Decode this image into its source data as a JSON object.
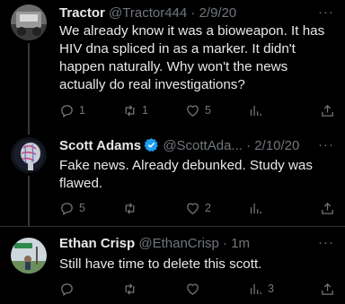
{
  "tweets": [
    {
      "name": "Tractor",
      "handle": "@Tractor444",
      "time": "· 2/9/20",
      "text": "We already know it was a bioweapon. It has HIV dna spliced in as a marker. It didn't happen naturally. Why won't the news actually do real investigations?",
      "replies": "1",
      "retweets": "1",
      "likes": "5",
      "views": ""
    },
    {
      "name": "Scott Adams",
      "handle": "@ScottAda...",
      "time": "· 2/10/20",
      "verified": true,
      "text": "Fake news. Already debunked. Study was flawed.",
      "replies": "5",
      "retweets": "",
      "likes": "2",
      "views": ""
    },
    {
      "name": "Ethan Crisp",
      "handle": "@EthanCrisp",
      "time": "· 1m",
      "text": "Still have time to delete this scott.",
      "replies": "",
      "retweets": "",
      "likes": "",
      "views": "3"
    }
  ],
  "icons": {
    "reply": "reply-icon",
    "retweet": "retweet-icon",
    "like": "heart-icon",
    "views": "views-icon",
    "share": "share-icon",
    "more": "more-icon"
  },
  "colors": {
    "background": "#000000",
    "muted": "#71767b",
    "verified": "#1d9bf0"
  }
}
